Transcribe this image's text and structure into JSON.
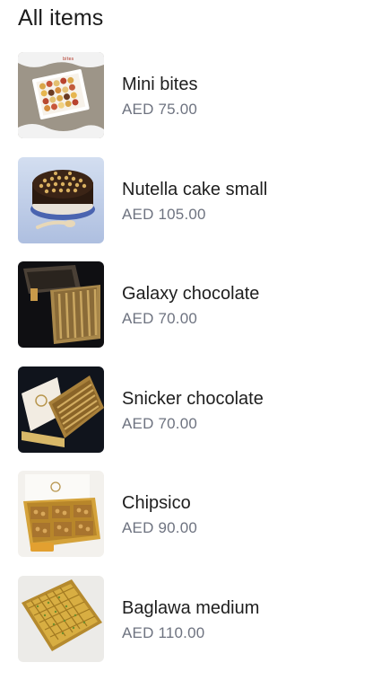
{
  "page": {
    "title": "All items"
  },
  "items": [
    {
      "name": "Mini bites",
      "price": "AED 75.00",
      "image": "platter-photo"
    },
    {
      "name": "Nutella cake small",
      "price": "AED 105.00",
      "image": "cake-photo"
    },
    {
      "name": "Galaxy chocolate",
      "price": "AED 70.00",
      "image": "chocolate-box-photo"
    },
    {
      "name": "Snicker chocolate",
      "price": "AED 70.00",
      "image": "chocolate-box-photo"
    },
    {
      "name": "Chipsico",
      "price": "AED 90.00",
      "image": "sweets-box-photo"
    },
    {
      "name": "Baglawa medium",
      "price": "AED 110.00",
      "image": "baklava-tray-photo"
    }
  ]
}
